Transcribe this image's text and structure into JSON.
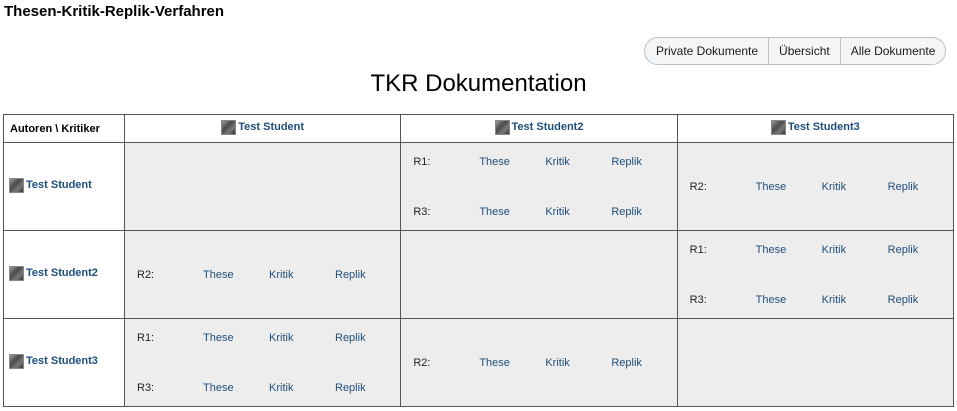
{
  "app": {
    "title": "Thesen-Kritik-Replik-Verfahren"
  },
  "nav": {
    "private_docs": "Private Dokumente",
    "overview": "Übersicht",
    "all_docs": "Alle Dokumente"
  },
  "page": {
    "title": "TKR Dokumentation"
  },
  "table": {
    "corner": "Autoren \\ Kritiker",
    "columns": [
      "Test Student",
      "Test Student2",
      "Test Student3"
    ],
    "rows": [
      {
        "author": "Test Student",
        "cells": [
          [],
          [
            {
              "label": "R1:",
              "these": "These",
              "kritik": "Kritik",
              "replik": "Replik"
            },
            {
              "label": "R3:",
              "these": "These",
              "kritik": "Kritik",
              "replik": "Replik"
            }
          ],
          [
            {
              "label": "R2:",
              "these": "These",
              "kritik": "Kritik",
              "replik": "Replik"
            }
          ]
        ]
      },
      {
        "author": "Test Student2",
        "cells": [
          [
            {
              "label": "R2:",
              "these": "These",
              "kritik": "Kritik",
              "replik": "Replik"
            }
          ],
          [],
          [
            {
              "label": "R1:",
              "these": "These",
              "kritik": "Kritik",
              "replik": "Replik"
            },
            {
              "label": "R3:",
              "these": "These",
              "kritik": "Kritik",
              "replik": "Replik"
            }
          ]
        ]
      },
      {
        "author": "Test Student3",
        "cells": [
          [
            {
              "label": "R1:",
              "these": "These",
              "kritik": "Kritik",
              "replik": "Replik"
            },
            {
              "label": "R3:",
              "these": "These",
              "kritik": "Kritik",
              "replik": "Replik"
            }
          ],
          [
            {
              "label": "R2:",
              "these": "These",
              "kritik": "Kritik",
              "replik": "Replik"
            }
          ],
          []
        ]
      }
    ]
  }
}
